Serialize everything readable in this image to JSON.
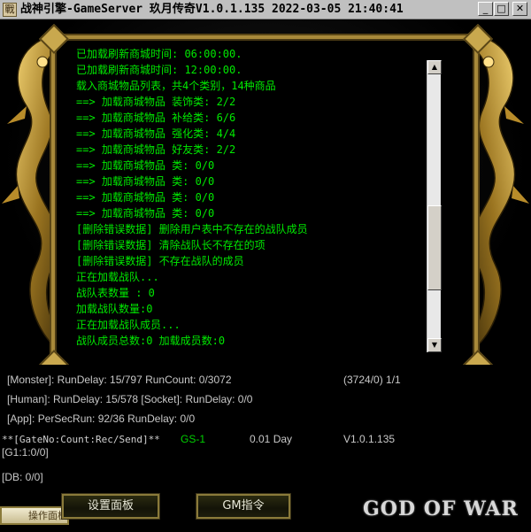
{
  "window": {
    "app_icon_glyph": "戰",
    "title": "战神引擎-GameServer 玖月传奇V1.0.1.135 2022-03-05 21:40:41",
    "min_glyph": "_",
    "max_glyph": "□",
    "close_glyph": "✕"
  },
  "log": {
    "lines": [
      "已加载刷新商城时间: 06:00:00.",
      "已加载刷新商城时间: 12:00:00.",
      "载入商城物品列表，共4个类别，14种商品",
      "==> 加载商城物品 装饰类: 2/2",
      "==> 加载商城物品 补给类: 6/6",
      "==> 加载商城物品 强化类: 4/4",
      "==> 加载商城物品 好友类: 2/2",
      "==> 加载商城物品 类: 0/0",
      "==> 加载商城物品 类: 0/0",
      "==> 加载商城物品 类: 0/0",
      "==> 加载商城物品 类: 0/0",
      "    [删除错误数据] 删除用户表中不存在的战队成员",
      "    [删除错误数据] 清除战队长不存在的项",
      "    [删除错误数据] 不存在战队的成员",
      "    正在加载战队...",
      "    战队表数量 : 0",
      "    加载战队数量:0",
      "    正在加载战队成员...",
      "    战队成员总数:0 加载成员数:0"
    ]
  },
  "scrollbar": {
    "up_glyph": "▲",
    "down_glyph": "▼"
  },
  "status": {
    "monster": "[Monster]: RunDelay: 15/797  RunCount: 0/3072",
    "monster_right": "(3724/0) 1/1",
    "human": "[Human]: RunDelay: 15/578  [Socket]: RunDelay: 0/0",
    "app": "[App]: PerSecRun: 92/36  RunDelay: 0/0",
    "gate_header": "**[GateNo:Count:Rec/Send]**",
    "gate_name": "GS-1",
    "gate_uptime": "0.01 Day",
    "gate_version": "V1.0.1.135",
    "gate_entry": "[G1:1:0/0]",
    "db": "[DB: 0/0]"
  },
  "buttons": {
    "operate_panel": "操作面板",
    "settings_panel": "设置面板",
    "gm_command": "GM指令"
  },
  "logo": {
    "text": "GOD OF WAR"
  }
}
